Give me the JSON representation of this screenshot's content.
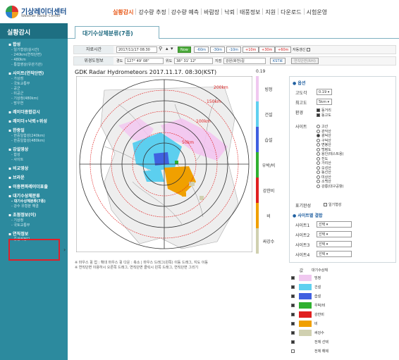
{
  "header": {
    "logo_title": "기상레이더센터",
    "logo_sub": "Weather Radar Center",
    "nav": [
      "실황감시",
      "강수량 추정",
      "강수량 예측",
      "바람장",
      "낙뢰",
      "태풍정보",
      "지원",
      "다운로드",
      "시험운영"
    ]
  },
  "sidebar": {
    "title": "실황감시",
    "groups": [
      {
        "label": "합성",
        "items": [
          "- 일기형성(실시간)",
          "- 240km(연직단면)",
          "- 480km",
          "- 통합영상(유관기관)"
        ]
      },
      {
        "label": "사이트(연직단면)",
        "items": [
          "- 가상점",
          "- 국토교통부",
          "- 공군",
          "- 미공군",
          "- 기상청(480km)",
          "- 방우연"
        ]
      },
      {
        "label": "레이더종합감시",
        "items": []
      },
      {
        "label": "레이더+낙뢰+위성",
        "items": []
      },
      {
        "label": "한중일",
        "items": [
          "- 한중일합성(240km)",
          "- 한중일합성(480km)"
        ]
      },
      {
        "label": "강설영상",
        "items": [
          "- 합성",
          "- 사이트"
        ]
      },
      {
        "label": "비교영상",
        "items": []
      },
      {
        "label": "브라운",
        "items": []
      },
      {
        "label": "이중편파레이더표출",
        "items": []
      },
      {
        "label": "대기수상체분류",
        "items": [
          "- 대기수상체분류(7종)",
          "- 강수 유형분 해결"
        ]
      },
      {
        "label": "초점정보(이)",
        "items": [
          "- 기상청",
          "- 국토교통부"
        ]
      },
      {
        "label": "연직정보",
        "items": [
          "- 중관적정보"
        ]
      }
    ]
  },
  "tab": {
    "label": "대기수상체분류(7종)"
  },
  "controls": {
    "time_label": "자료시간",
    "time_value": "2017/11/17 08:30",
    "now": "Now",
    "steps": [
      "-60m",
      "-30m",
      "-10m",
      "+10m",
      "+30m",
      "+60m"
    ],
    "auto_label": "자동갱신",
    "pos_label": "위경도정보",
    "lon_label": "경도",
    "lon_value": "127° 49' 08\"",
    "lat_label": "위도",
    "lat_value": "38° 31' 12\"",
    "place_label": "지점",
    "place_value": "강원(화천)길",
    "tz_btn": "KST로",
    "vert_btn": "연직단면(RHI)"
  },
  "map": {
    "title": "GDK Radar Hydrometeors 2017.11.17. 08:30(KST)",
    "rings": [
      "50km",
      "100km",
      "150km",
      "200km"
    ]
  },
  "legend": {
    "top_value": "0.19",
    "items": [
      {
        "label": "빙정",
        "color": "#f0c8f0"
      },
      {
        "label": "건설",
        "color": "#60d0f0"
      },
      {
        "label": "습설",
        "color": "#4060e0"
      },
      {
        "label": "우박/비",
        "color": "#30b030"
      },
      {
        "label": "강한비",
        "color": "#e02020"
      },
      {
        "label": "비",
        "color": "#f0a000"
      },
      {
        "label": "싸강수",
        "color": "#d0d0b0"
      }
    ]
  },
  "options": {
    "title": "옵션",
    "elev_label": "고도각",
    "elev_value": "0.19",
    "alt_label": "최고도",
    "alt_value": "5km",
    "range_label": "환경",
    "range_opts": [
      "동거리",
      "동고도"
    ],
    "site_label": "사이트",
    "sites": [
      "고산",
      "관악산",
      "광덕산",
      "구덕산",
      "면봉산",
      "백령도",
      "용인(테스트용)",
      "진도",
      "가리산",
      "오성산",
      "동선산",
      "미상산",
      "소백산",
      "강릉(대구공항)"
    ],
    "compare_label": "표기완성",
    "compare_opt": "일기형성",
    "multi_title": "사이트별 결합",
    "multi_rows": [
      "사이트1",
      "사이트2",
      "사이트3",
      "사이트4"
    ],
    "select_text": "선택"
  },
  "hints": [
    "※ 마우스 휠 업 : 확대 마우스 휠 다운 : 축소 | 마우스 드래그(왼쪽) 이동 드래그, 지도 이동",
    "※ 연직단면 이용하시 오른쪽 드래그, 연직단면 클릭시 왼쪽 드래그, 연직단면 그리기"
  ],
  "class_table": {
    "header_left": "값",
    "header_right": "대기수상체",
    "rows": [
      "빙정",
      "건설",
      "습설",
      "우박/비",
      "강한비",
      "비",
      "싸강수"
    ],
    "all_select": "전체 선택",
    "all_clear": "전체 해제"
  }
}
